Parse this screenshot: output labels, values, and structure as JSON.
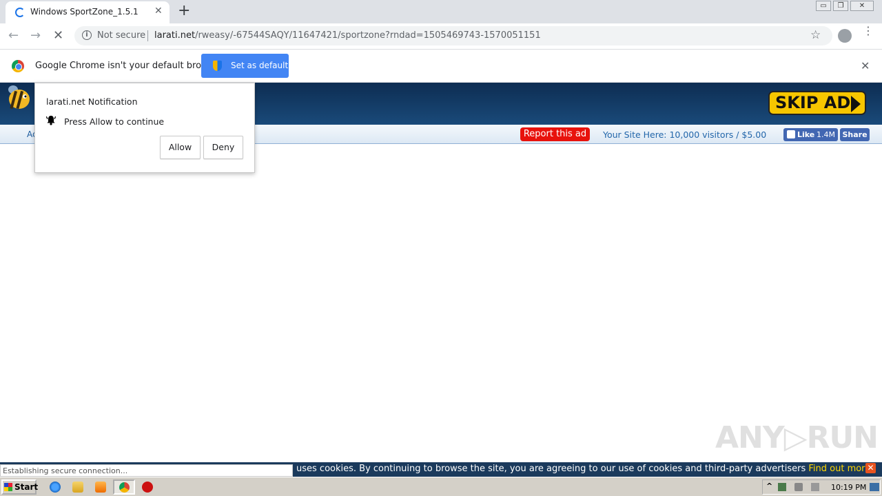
{
  "browser": {
    "tab_title": "Windows SportZone_1.5.1",
    "tab_close": "✕",
    "new_tab": "+",
    "window_controls": [
      "▭",
      "❐",
      "✕"
    ],
    "not_secure": "Not secure",
    "url_host": "larati.net",
    "url_path": "/rweasy/-67544SAQY/11647421/sportzone?rndad=1505469743-1570051151",
    "nav_back": "←",
    "nav_forward": "→",
    "reload": "✕",
    "star": "☆",
    "menu": "⋮"
  },
  "infobar": {
    "message": "Google Chrome isn't your default browser",
    "button_label": "Set as default",
    "close": "✕"
  },
  "page": {
    "sub_left": "Ac",
    "report_ad": "Report this ad",
    "your_site": "Your Site Here: 10,000 visitors / $5.00",
    "fb_like_label": "Like",
    "fb_like_count": "1.4M",
    "fb_share": "Share",
    "skip_ad": "SKIP AD"
  },
  "notification": {
    "title": "larati.net Notification",
    "message": "Press Allow to continue",
    "allow": "Allow",
    "deny": "Deny"
  },
  "cookie_bar": {
    "text": "uses cookies. By continuing to browse the site, you are agreeing to our use of cookies and third-party advertisers",
    "link": "Find out more.",
    "close": "✕"
  },
  "status": "Establishing secure connection...",
  "watermark": "ANY▷RUN",
  "taskbar": {
    "start": "Start",
    "clock": "10:19 PM",
    "tray_arrow": "^"
  },
  "colors": {
    "accent_blue": "#4285f4",
    "report_red": "#e8120c",
    "skip_yellow": "#f7c600",
    "header_navy": "#0d2d52",
    "cookie_link": "#ffd700"
  }
}
